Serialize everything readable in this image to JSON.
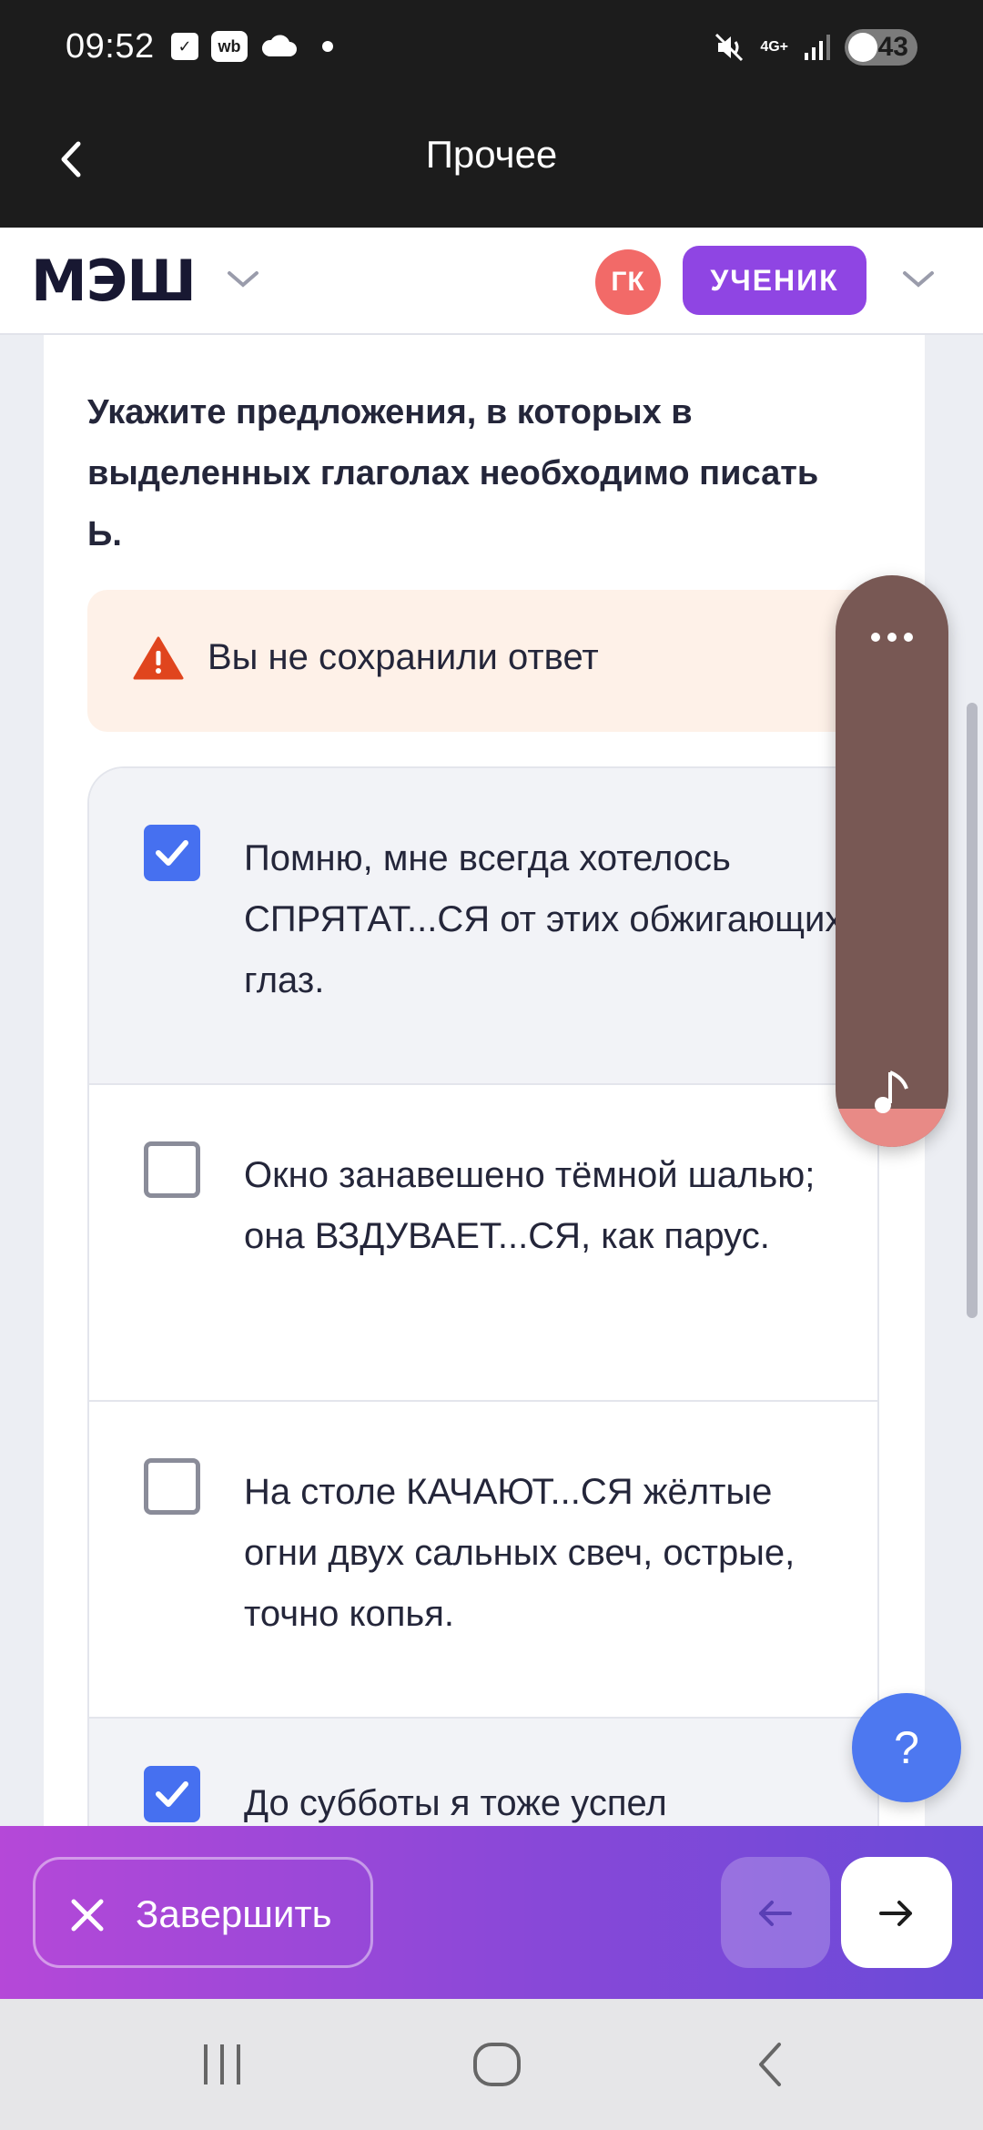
{
  "status_bar": {
    "time": "09:52",
    "wb_label": "wb",
    "network": "4G+",
    "battery": "43"
  },
  "app_bar": {
    "title": "Прочее"
  },
  "header": {
    "logo": "МЭШ",
    "avatar_initials": "ГК",
    "role": "УЧЕНИК"
  },
  "question": {
    "text": "Укажите предложения, в которых в выделенных глаголах необходимо писать Ь."
  },
  "warning": {
    "text": "Вы не сохранили ответ",
    "color": "#e0451e"
  },
  "options": [
    {
      "text": "Помню, мне всегда хотелось СПРЯТАТ...СЯ от этих обжигающих глаз.",
      "checked": true
    },
    {
      "text": "Окно занавешено тёмной шалью; она ВЗДУВАЕТ...СЯ, как парус.",
      "checked": false
    },
    {
      "text": "На столе КАЧАЮТ...СЯ жёлтые огни двух сальных свеч, острые, точно копья.",
      "checked": false
    },
    {
      "text": "До субботы я тоже успел",
      "checked": true
    }
  ],
  "help_button": {
    "label": "?"
  },
  "action_bar": {
    "finish_label": "Завершить"
  },
  "colors": {
    "accent_blue": "#4670f0",
    "role_purple": "#8f45e3",
    "avatar_red": "#f26a68"
  }
}
